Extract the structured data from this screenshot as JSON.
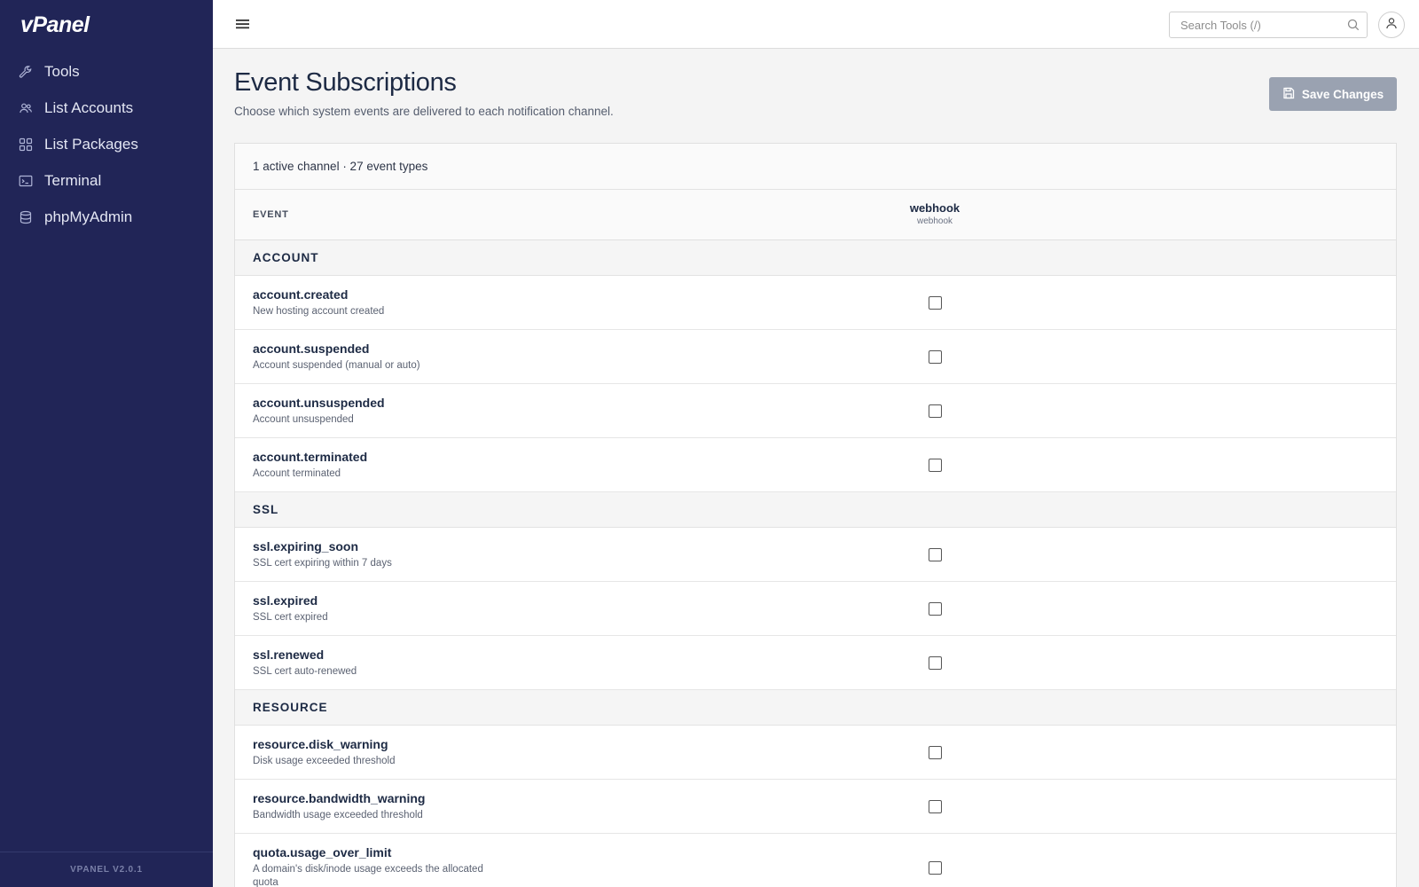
{
  "app": {
    "logo": "vPanel",
    "version": "VPANEL V2.0.1"
  },
  "sidebar": {
    "items": [
      {
        "label": "Tools",
        "icon": "wrench-icon"
      },
      {
        "label": "List Accounts",
        "icon": "users-icon"
      },
      {
        "label": "List Packages",
        "icon": "grid-icon"
      },
      {
        "label": "Terminal",
        "icon": "terminal-icon"
      },
      {
        "label": "phpMyAdmin",
        "icon": "database-icon"
      }
    ]
  },
  "topbar": {
    "search_placeholder": "Search Tools (/)"
  },
  "page": {
    "title": "Event Subscriptions",
    "subtitle": "Choose which system events are delivered to each notification channel.",
    "save_label": "Save Changes"
  },
  "table": {
    "summary": "1 active channel · 27 event types",
    "event_header": "EVENT",
    "channel": {
      "name": "webhook",
      "type": "webhook"
    },
    "groups": [
      {
        "name": "ACCOUNT",
        "events": [
          {
            "name": "account.created",
            "desc": "New hosting account created",
            "checked": false
          },
          {
            "name": "account.suspended",
            "desc": "Account suspended (manual or auto)",
            "checked": false
          },
          {
            "name": "account.unsuspended",
            "desc": "Account unsuspended",
            "checked": false
          },
          {
            "name": "account.terminated",
            "desc": "Account terminated",
            "checked": false
          }
        ]
      },
      {
        "name": "SSL",
        "events": [
          {
            "name": "ssl.expiring_soon",
            "desc": "SSL cert expiring within 7 days",
            "checked": false
          },
          {
            "name": "ssl.expired",
            "desc": "SSL cert expired",
            "checked": false
          },
          {
            "name": "ssl.renewed",
            "desc": "SSL cert auto-renewed",
            "checked": false
          }
        ]
      },
      {
        "name": "RESOURCE",
        "events": [
          {
            "name": "resource.disk_warning",
            "desc": "Disk usage exceeded threshold",
            "checked": false
          },
          {
            "name": "resource.bandwidth_warning",
            "desc": "Bandwidth usage exceeded threshold",
            "checked": false
          },
          {
            "name": "quota.usage_over_limit",
            "desc": "A domain's disk/inode usage exceeds the allocated quota",
            "checked": false
          }
        ]
      }
    ]
  },
  "colors": {
    "sidebar_bg": "#212557",
    "accent": "#1d2a44",
    "button_disabled": "#9aa2b1"
  }
}
